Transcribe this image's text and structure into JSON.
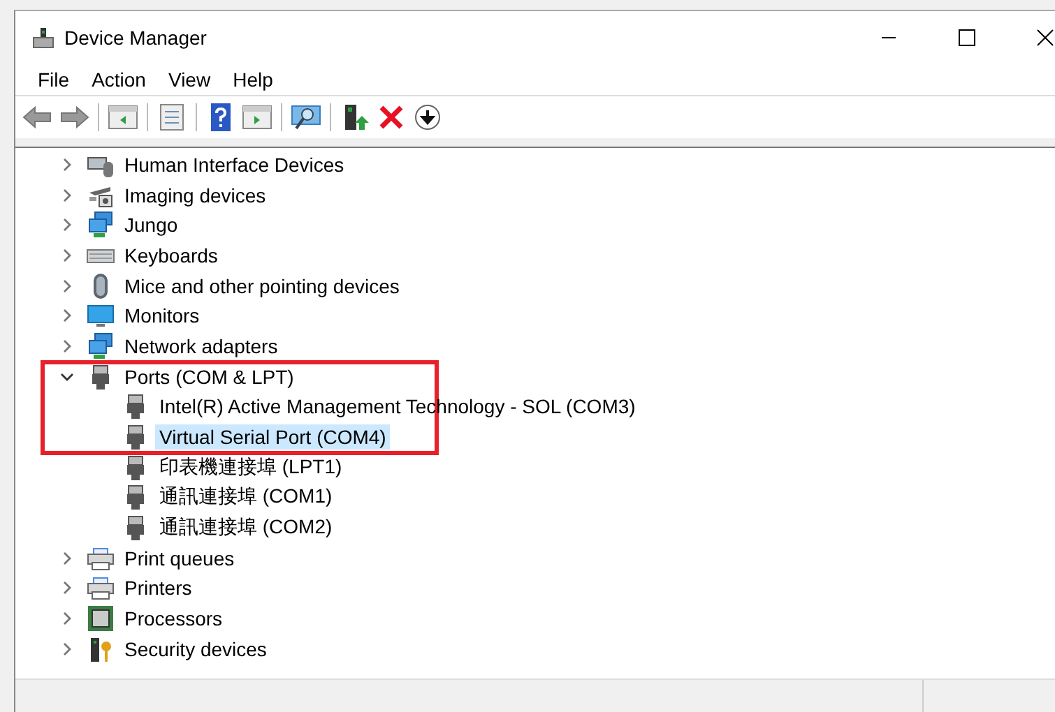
{
  "window": {
    "title": "Device Manager"
  },
  "menu": [
    "File",
    "Action",
    "View",
    "Help"
  ],
  "tree": {
    "items": [
      {
        "label": "Human Interface Devices",
        "kind": "hid",
        "expanded": false,
        "selected": false
      },
      {
        "label": "Imaging devices",
        "kind": "camera",
        "expanded": false,
        "selected": false
      },
      {
        "label": "Jungo",
        "kind": "network",
        "expanded": false,
        "selected": false
      },
      {
        "label": "Keyboards",
        "kind": "keyboard",
        "expanded": false,
        "selected": false
      },
      {
        "label": "Mice and other pointing devices",
        "kind": "mouse",
        "expanded": false,
        "selected": false
      },
      {
        "label": "Monitors",
        "kind": "monitor",
        "expanded": false,
        "selected": false
      },
      {
        "label": "Network adapters",
        "kind": "network",
        "expanded": false,
        "selected": false
      },
      {
        "label": "Ports (COM & LPT)",
        "kind": "port",
        "expanded": true,
        "selected": false,
        "children": [
          {
            "label": "Intel(R) Active Management Technology - SOL (COM3)",
            "kind": "port",
            "selected": false
          },
          {
            "label": "Virtual Serial Port (COM4)",
            "kind": "port",
            "selected": true
          },
          {
            "label": "印表機連接埠 (LPT1)",
            "kind": "port",
            "selected": false
          },
          {
            "label": "通訊連接埠 (COM1)",
            "kind": "port",
            "selected": false
          },
          {
            "label": "通訊連接埠 (COM2)",
            "kind": "port",
            "selected": false
          }
        ]
      },
      {
        "label": "Print queues",
        "kind": "printer",
        "expanded": false,
        "selected": false
      },
      {
        "label": "Printers",
        "kind": "printer",
        "expanded": false,
        "selected": false
      },
      {
        "label": "Processors",
        "kind": "cpu",
        "expanded": false,
        "selected": false
      },
      {
        "label": "Security devices",
        "kind": "security",
        "expanded": false,
        "selected": false
      }
    ]
  }
}
